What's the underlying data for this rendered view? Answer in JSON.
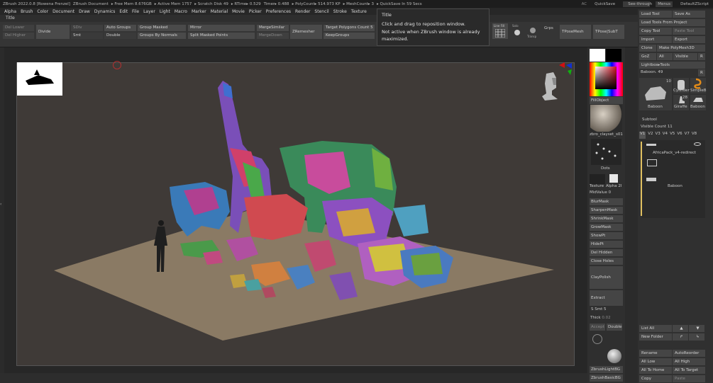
{
  "titlebar": {
    "app": "ZBrush 2022.0.8 [Rowena Frenzel]",
    "doc": "ZBrush Document",
    "free_mem": "▸ Free Mem 8.676GB",
    "active_mem": "▸ Active Mem 1757",
    "scratch": "▸ Scratch Disk 49",
    "rtime": "▸ RTime▸ 0.529",
    "timer": "Timer▸ 0.488",
    "polycount": "▸ PolyCount▸ 514.973 KP",
    "meshcount": "▸ MeshCount▸ 3",
    "quicksave_in": "▸ QuickSave In 59 Secs",
    "ac": "AC",
    "quicksave": "QuickSave",
    "seethrough": "See-through",
    "see_value": "0",
    "menus": "Menus",
    "zscript": "DefaultZScript"
  },
  "menubar": [
    "Alpha",
    "Brush",
    "Color",
    "Document",
    "Draw",
    "Dynamics",
    "Edit",
    "File",
    "Layer",
    "Light",
    "Macro",
    "Marker",
    "Material",
    "Movie",
    "Picker",
    "Preferences",
    "Render",
    "Stencil",
    "Stroke",
    "Texture"
  ],
  "menubar_right": {
    "load_tool": "Load Tool",
    "save_as": "Save As"
  },
  "title_row": "Title",
  "toolstrip": {
    "del_lower": "Del Lower",
    "del_higher": "Del Higher",
    "divide": "Divide",
    "sdiv": "SDiv",
    "smt": "Smt",
    "auto_groups": "Auto Groups",
    "double": "Double",
    "group_masked": "Group Masked",
    "groups_by_normals": "Groups By Normals",
    "mirror": "Mirror",
    "split_masked": "Split Masked Points",
    "merge_similar": "MergeSimilar",
    "merge_down": "MergeDown",
    "zremesher": "ZRemesher",
    "target_polys": "Target Polygons Count",
    "target_value": "5",
    "keep_groups": "KeepGroups",
    "grps": "Grps",
    "tpose_mesh": "TPoseMesh",
    "tpose_subt": "TPose|SubT",
    "line_fill": "Line Fill",
    "solo": "Solo",
    "transp": "Transp",
    "xpose": "Xpose"
  },
  "tooltip": {
    "title": "Title",
    "line1": "Click and drag to reposition window.",
    "line2": "Not active when ZBrush window is already",
    "line3": "maximized."
  },
  "shelf": {
    "fill_object": "FillObject",
    "material": "zbro_clayset_s01",
    "dots": "Dots",
    "texture": "Texture",
    "alpha": "Alpha 2I",
    "mid_value": "MidValue",
    "mid_num": "0",
    "blur_mask": "BlurMask",
    "sharpen_mask": "SharpenMask",
    "shrink_mask": "ShrinkMask",
    "grow_mask": "GrowMask",
    "show_pt": "ShowPt",
    "hide_pt": "HidePt",
    "del_hidden": "Del Hidden",
    "close_holes": "Close Holes",
    "clay_polish": "ClayPolish",
    "extract": "Extract",
    "s_smt": "S Smt",
    "s_smt_val": "5",
    "thick": "Thick",
    "thick_val": "0.02",
    "accept": "Accept",
    "double": "Double",
    "light_bg": "ZbrushLightBG",
    "basic_bg": "ZbrushBasicBG"
  },
  "palette": {
    "load_tools_project": "Load Tools From Project",
    "copy_tool": "Copy Tool",
    "paste_tool": "Paste Tool",
    "import": "Import",
    "export": "Export",
    "clone": "Clone",
    "make_polymesh": "Make PolyMesh3D",
    "goz": "GoZ",
    "all": "All",
    "visible": "Visible",
    "r": "R",
    "lightbox": "Lightbox▸Tools",
    "baboon_label": "Baboon. 49",
    "count": "10",
    "cylinder": "Cylinder",
    "simple": "SimpleB",
    "giraffe": "Giraffe",
    "baboon": "Baboon",
    "baboon2": "Baboon",
    "num28": "28",
    "subtool": "Subtool",
    "visible_count": "Visible Count",
    "visible_count_val": "11",
    "versions": [
      "V1",
      "V2",
      "V3",
      "V4",
      "V5",
      "V6",
      "V7",
      "V8"
    ],
    "africa": "AfricaPack_v4-redirect",
    "baboon_sub": "Baboon",
    "list_all": "List All",
    "new_folder": "New Folder",
    "rename": "Rename",
    "auto_reorder": "AutoReorder",
    "all_low": "All Low",
    "all_high": "All High",
    "all_to_home": "All To Home",
    "all_to_target": "All To Target",
    "copy": "Copy",
    "paste": "Paste"
  }
}
